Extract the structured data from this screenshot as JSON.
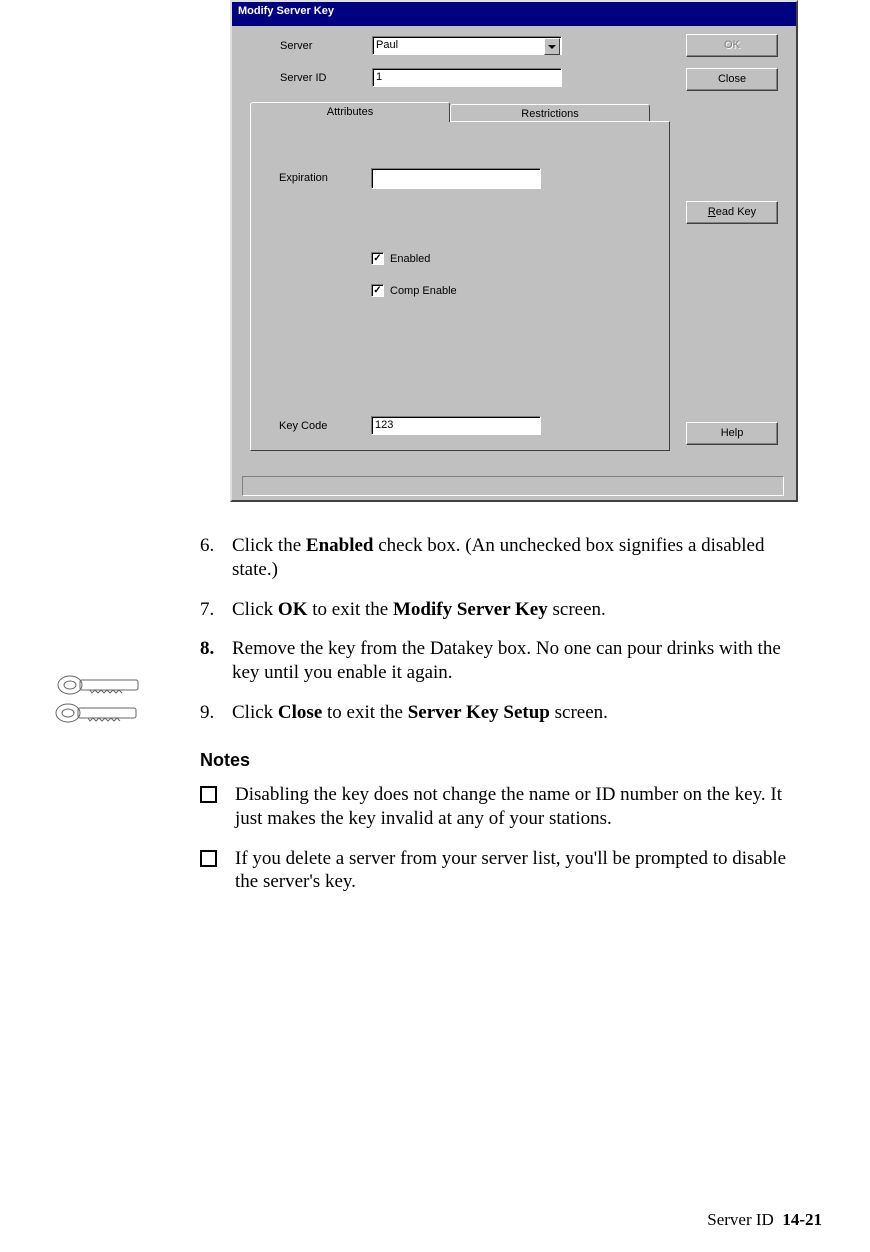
{
  "dialog": {
    "title": "Modify Server Key",
    "server_label": "Server",
    "server_value": "Paul",
    "server_id_label": "Server ID",
    "server_id_value": "1",
    "ok_label": "OK",
    "close_label": "Close",
    "tabs": {
      "attributes": "Attributes",
      "restrictions": "Restrictions"
    },
    "expiration_label": "Expiration",
    "expiration_value": "",
    "read_key_label": "Read Key",
    "enabled_label": "Enabled",
    "comp_enable_label": "Comp Enable",
    "key_code_label": "Key Code",
    "key_code_value": "123",
    "help_label": "Help"
  },
  "steps": [
    {
      "num": "6.",
      "parts": [
        "Click the ",
        "Enabled",
        " check box. (An unchecked box signifies a disabled state.)"
      ]
    },
    {
      "num": "7.",
      "parts": [
        "Click ",
        "OK",
        " to exit the ",
        "Modify Server Key",
        " screen."
      ]
    },
    {
      "num": "8.",
      "num_bold": true,
      "parts": [
        "Remove the key from the Datakey box. No one can pour drinks with the key until you enable it again."
      ]
    },
    {
      "num": "9.",
      "parts": [
        "Click ",
        "Close",
        " to exit the ",
        "Server Key Setup",
        " screen."
      ]
    }
  ],
  "notes_heading": "Notes",
  "notes": [
    "Disabling the key does not change the name or ID number on the key. It just makes the key invalid at any of your stations.",
    "If you delete a server from your server list, you'll be prompted to disable the server's key."
  ],
  "footer": {
    "label": "Server ID",
    "page": "14-21"
  },
  "checkmark": "✓"
}
